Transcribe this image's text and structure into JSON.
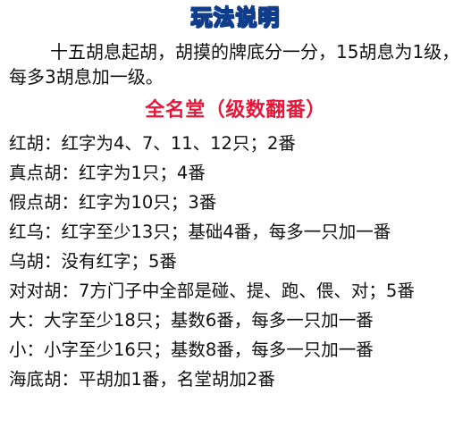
{
  "title": "玩法说明",
  "intro": "十五胡息起胡，胡摸的牌底分一分，15胡息为1级，每多3胡息加一级。",
  "section_title": "全名堂（级数翻番）",
  "rules": [
    {
      "name": "红胡：",
      "desc": "红字为4、7、11、12只；2番"
    },
    {
      "name": "真点胡：",
      "desc": "红字为1只；4番"
    },
    {
      "name": "假点胡：",
      "desc": "红字为10只；3番"
    },
    {
      "name": "红乌：",
      "desc": "红字至少13只；基础4番，每多一只加一番"
    },
    {
      "name": "乌胡：",
      "desc": "没有红字；5番"
    },
    {
      "name": "对对胡：",
      "desc": "7方门子中全部是碰、提、跑、偎、对；5番"
    },
    {
      "name": "大：",
      "desc": "大字至少18只；基数6番，每多一只加一番"
    },
    {
      "name": "小：",
      "desc": "小字至少16只；基数8番，每多一只加一番"
    },
    {
      "name": "海底胡：",
      "desc": "平胡加1番，名堂胡加2番"
    }
  ]
}
